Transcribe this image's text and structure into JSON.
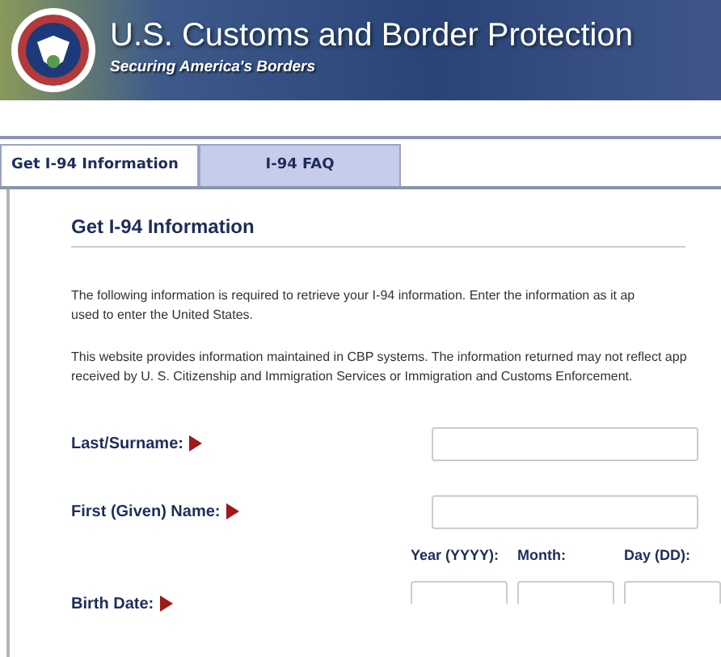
{
  "header": {
    "title": "U.S. Customs and Border Protection",
    "subtitle": "Securing America's Borders"
  },
  "tabs": [
    {
      "label": "Get I-94 Information",
      "selected": true
    },
    {
      "label": "I-94 FAQ",
      "selected": false
    }
  ],
  "heading": "Get I-94 Information",
  "paragraphs": [
    [
      "The following information is required to retrieve your I-94 information. Enter the information as it ap",
      "used to enter the United States."
    ],
    [
      "This website provides information maintained in CBP systems. The information returned may not reflect app",
      "received by U. S. Citizenship and Immigration Services or Immigration and Customs Enforcement."
    ]
  ],
  "fields": [
    {
      "kind": "text",
      "label": "Last/Surname:"
    },
    {
      "kind": "text",
      "label": "First (Given) Name:"
    },
    {
      "kind": "date",
      "label": "Birth Date:",
      "parts": [
        "Year (YYYY):",
        "Month:",
        "Day (DD):"
      ]
    }
  ]
}
